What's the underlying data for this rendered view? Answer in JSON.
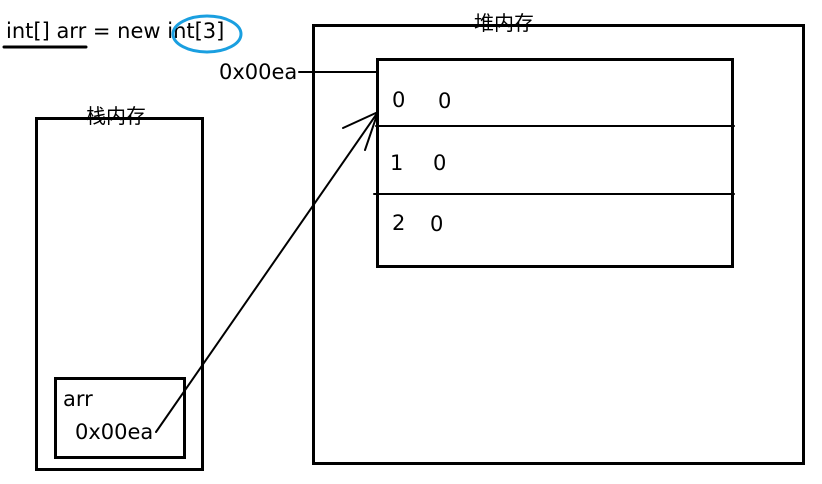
{
  "code_line": {
    "prefix": "int[] arr = new ",
    "highlight": "int[3]",
    "highlight_color": "#1a9fe0"
  },
  "heap": {
    "title": "堆内存",
    "address": "0x00ea",
    "rows": [
      {
        "index": "0",
        "value": "0"
      },
      {
        "index": "1",
        "value": "0"
      },
      {
        "index": "2",
        "value": "0"
      }
    ]
  },
  "stack": {
    "title": "栈内存",
    "var_name": "arr",
    "var_value": "0x00ea"
  }
}
